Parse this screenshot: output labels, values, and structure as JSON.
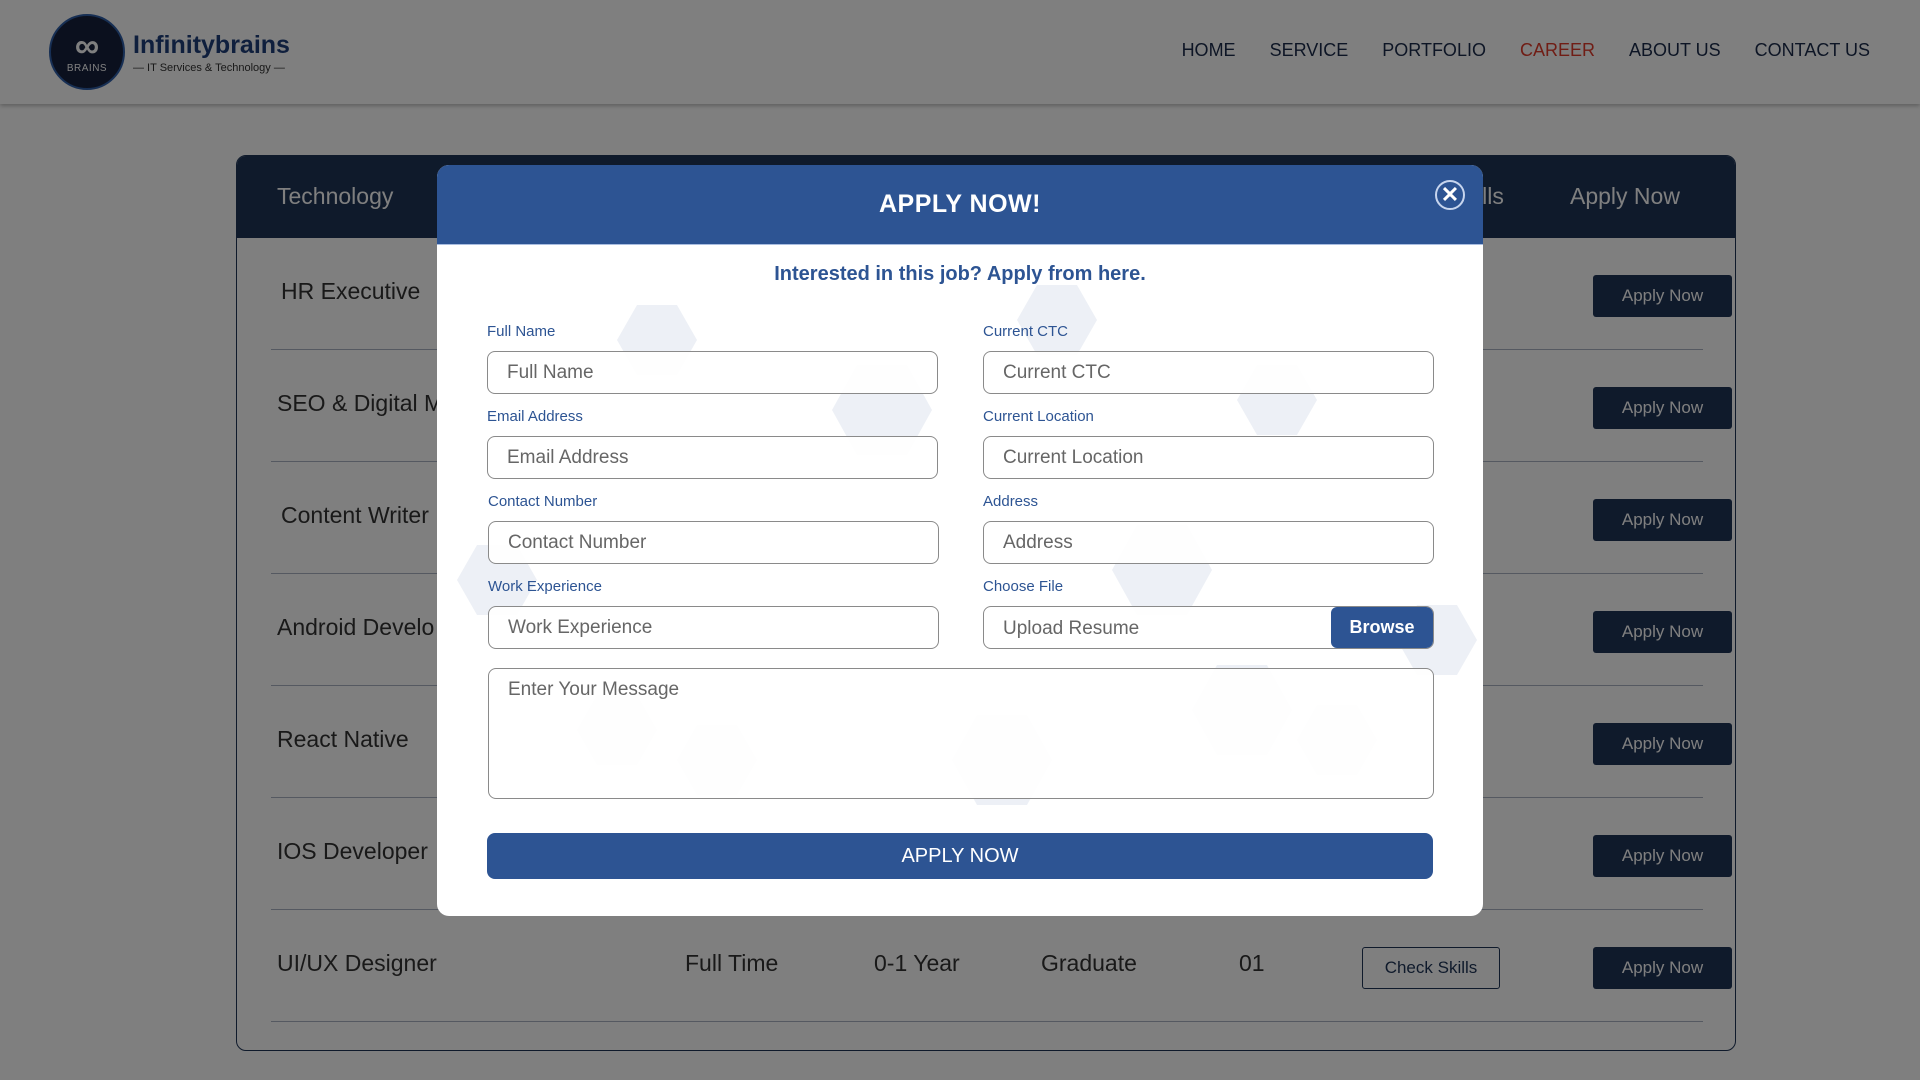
{
  "header": {
    "logo_name": "Infinitybrains",
    "logo_tagline": "— IT Services & Technology —",
    "logo_badge": "BRAINS",
    "nav": [
      "HOME",
      "SERVICE",
      "PORTFOLIO",
      "CAREER",
      "ABOUT US",
      "CONTACT US"
    ],
    "active_nav": "CAREER"
  },
  "jobs": {
    "columns": {
      "technology": "Technology",
      "skills": "ills",
      "apply": "Apply Now"
    },
    "rows": [
      {
        "title": "HR Executive",
        "apply": "Apply Now"
      },
      {
        "title": "SEO & Digital M",
        "apply": "Apply Now"
      },
      {
        "title": "Content Writer",
        "apply": "Apply Now"
      },
      {
        "title": "Android Develo",
        "apply": "Apply Now"
      },
      {
        "title": "React Native",
        "apply": "Apply Now"
      },
      {
        "title": "IOS Developer",
        "apply": "Apply Now"
      },
      {
        "title": "UI/UX Designer",
        "type": "Full Time",
        "experience": "0-1 Year",
        "qualification": "Graduate",
        "openings": "01",
        "skills": "Check Skills",
        "apply": "Apply Now"
      }
    ]
  },
  "modal": {
    "title": "APPLY NOW!",
    "close": "✕",
    "subtitle": "Interested in this job? Apply from here.",
    "fields": {
      "full_name": {
        "label": "Full Name",
        "placeholder": "Full Name"
      },
      "email": {
        "label": "Email Address",
        "placeholder": "Email Address"
      },
      "contact": {
        "label": "Contact Number",
        "placeholder": "Contact Number"
      },
      "experience": {
        "label": "Work Experience",
        "placeholder": "Work Experience"
      },
      "ctc": {
        "label": "Current CTC",
        "placeholder": "Current CTC"
      },
      "location": {
        "label": "Current Location",
        "placeholder": "Current Location"
      },
      "address": {
        "label": "Address",
        "placeholder": "Address"
      },
      "file": {
        "label": "Choose File",
        "placeholder": "Upload Resume",
        "browse": "Browse"
      },
      "message": {
        "placeholder": "Enter Your Message"
      }
    },
    "submit": "APPLY NOW"
  },
  "colors": {
    "primary": "#2d5493",
    "dark_navy": "#1e3457",
    "active_nav": "#e03a2a"
  }
}
